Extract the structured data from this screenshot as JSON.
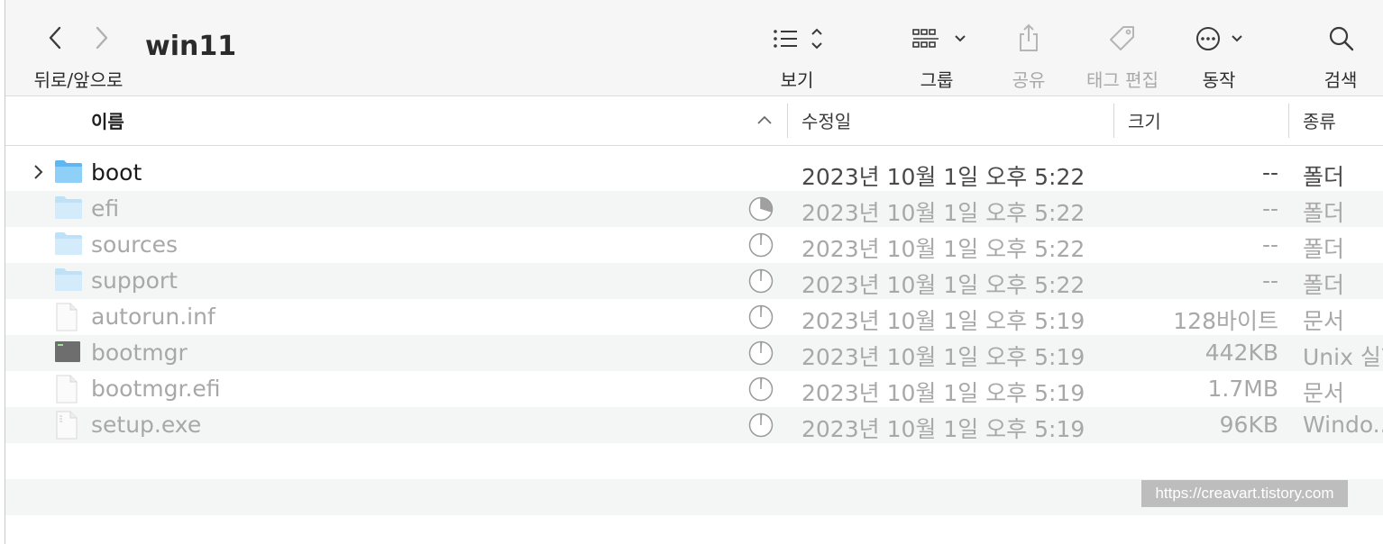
{
  "toolbar": {
    "back_forward_label": "뒤로/앞으로",
    "title": "win11",
    "view_label": "보기",
    "group_label": "그룹",
    "share_label": "공유",
    "tags_label": "태그 편집",
    "action_label": "동작",
    "search_label": "검색"
  },
  "columns": {
    "name": "이름",
    "modified": "수정일",
    "size": "크기",
    "kind": "종류"
  },
  "files": [
    {
      "name": "boot",
      "date": "2023년 10월 1일 오후 5:22",
      "size": "--",
      "kind": "폴더",
      "icon": "folder-icon",
      "state": "active",
      "progress": null
    },
    {
      "name": "efi",
      "date": "2023년 10월 1일 오후 5:22",
      "size": "--",
      "kind": "폴더",
      "icon": "folder-icon",
      "state": "copying",
      "progress": 0.3
    },
    {
      "name": "sources",
      "date": "2023년 10월 1일 오후 5:22",
      "size": "--",
      "kind": "폴더",
      "icon": "folder-icon",
      "state": "copying",
      "progress": 0.02
    },
    {
      "name": "support",
      "date": "2023년 10월 1일 오후 5:22",
      "size": "--",
      "kind": "폴더",
      "icon": "folder-icon",
      "state": "copying",
      "progress": 0.02
    },
    {
      "name": "autorun.inf",
      "date": "2023년 10월 1일 오후 5:19",
      "size": "128바이트",
      "kind": "문서",
      "icon": "document-icon",
      "state": "copying",
      "progress": 0.02
    },
    {
      "name": "bootmgr",
      "date": "2023년 10월 1일 오후 5:19",
      "size": "442KB",
      "kind": "Unix 실행",
      "icon": "terminal-icon",
      "state": "copying",
      "progress": 0.02
    },
    {
      "name": "bootmgr.efi",
      "date": "2023년 10월 1일 오후 5:19",
      "size": "1.7MB",
      "kind": "문서",
      "icon": "document-icon",
      "state": "copying",
      "progress": 0.02
    },
    {
      "name": "setup.exe",
      "date": "2023년 10월 1일 오후 5:19",
      "size": "96KB",
      "kind": "Windo...",
      "icon": "executable-icon",
      "state": "copying",
      "progress": 0.02
    }
  ],
  "watermark": "https://creavart.tistory.com",
  "colors": {
    "folder_blue": "#5fb6f0",
    "toolbar_bg": "#f6f6f6",
    "row_alt": "#f4f5f5",
    "dim_text": "#a8a8a8"
  }
}
